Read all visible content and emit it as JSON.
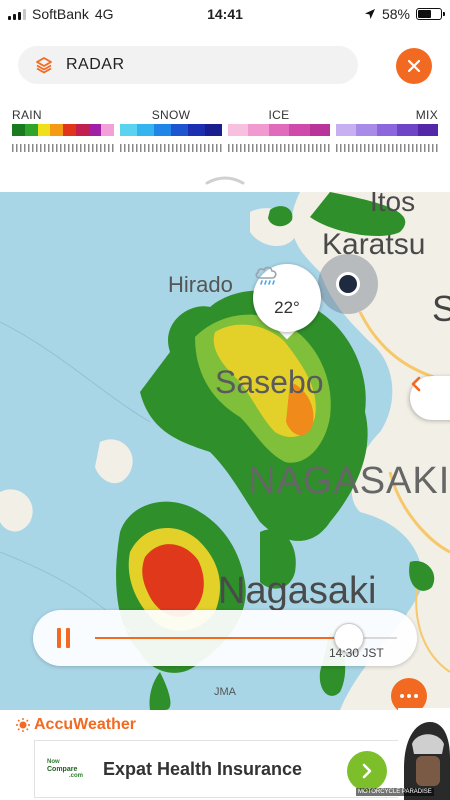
{
  "status_bar": {
    "carrier": "SoftBank",
    "network": "4G",
    "time": "14:41",
    "battery": "58%",
    "battery_level": 0.58
  },
  "search": {
    "label": "RADAR",
    "icon": "layers-icon",
    "close_icon": "close-icon"
  },
  "legend": [
    {
      "label": "RAIN",
      "colors": [
        "#1a7a1f",
        "#2fa52c",
        "#f0e019",
        "#f59a14",
        "#e03518",
        "#c11f4f",
        "#a11fa5",
        "#f4a0d8"
      ]
    },
    {
      "label": "SNOW",
      "colors": [
        "#5bd3f0",
        "#35b5f0",
        "#1f86e8",
        "#1d55d0",
        "#1c2fb0",
        "#1a1f90"
      ]
    },
    {
      "label": "ICE",
      "colors": [
        "#f6c0de",
        "#f09ad0",
        "#e06bbc",
        "#cf4aab",
        "#b8339a"
      ]
    },
    {
      "label": "MIX",
      "colors": [
        "#c6b0f2",
        "#a88ae8",
        "#8c66dc",
        "#6f45c8",
        "#5228a8"
      ]
    }
  ],
  "map": {
    "labels": {
      "itoshima": "Itos",
      "karatsu": "Karatsu",
      "hirado": "Hirado",
      "sasebo": "Sasebo",
      "nagasaki_pref": "NAGASAKI",
      "nagasaki_city": "Nagasaki",
      "edge_s": "S",
      "attribution": "JMA"
    },
    "weather_pin": {
      "icon": "cloud-rain-icon",
      "temperature": "22°"
    },
    "side_tab_icon": "chevron-left-icon"
  },
  "player": {
    "state_icon": "pause-icon",
    "progress": 0.84,
    "timestamp": "14:30 JST"
  },
  "more_icon": "more-icon",
  "brand": {
    "name": "AccuWeather",
    "icon": "sun-icon"
  },
  "ad": {
    "logo_line1": "Now",
    "logo_line2": "Compare",
    "logo_line3": ".com",
    "title": "Expat Health Insurance",
    "go_icon": "chevron-right-icon",
    "close_label": "✕"
  },
  "watermark": "MOTORCYCLE PARADISE",
  "colors": {
    "accent": "#f26a21",
    "sea": "#a9d6e7",
    "land": "#f2efe6",
    "ad_button": "#7cbf2a"
  }
}
